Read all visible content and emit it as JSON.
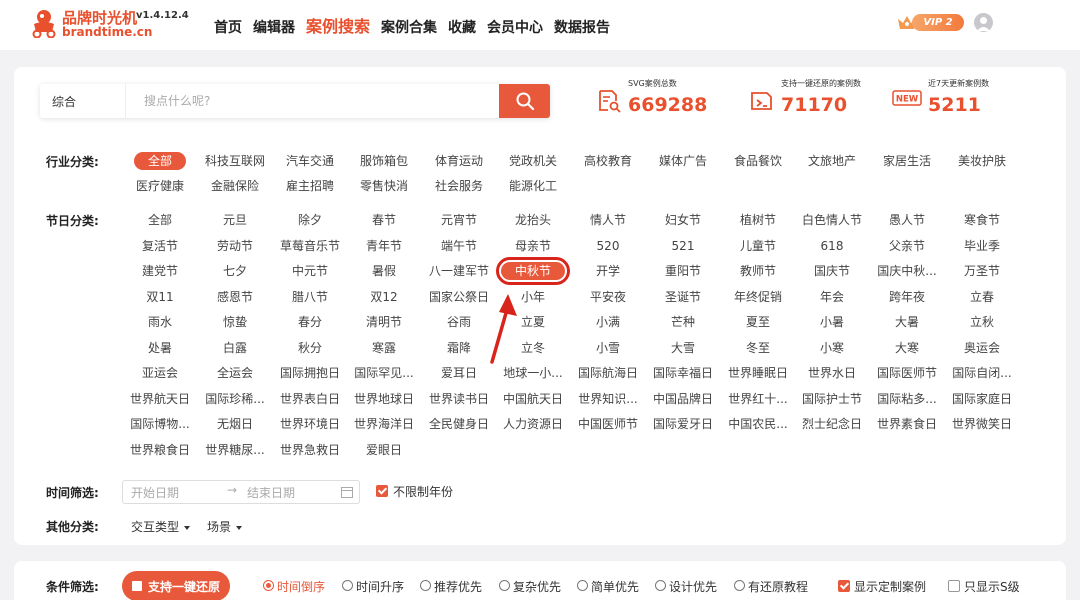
{
  "header": {
    "logo_name": "品牌时光机",
    "version": "v1.4.12.4",
    "domain": "brandtime.cn",
    "nav": [
      "首页",
      "编辑器",
      "案例搜索",
      "案例合集",
      "收藏",
      "会员中心",
      "数据报告"
    ],
    "active_nav": "案例搜索",
    "vip_label": "VIP 2"
  },
  "search": {
    "category": "综合",
    "placeholder": "搜点什么呢?"
  },
  "stats": [
    {
      "label": "SVG案例总数",
      "value": "669288",
      "icon": "document-search-icon"
    },
    {
      "label": "支持一键还原的案例数",
      "value": "71170",
      "icon": "restore-icon"
    },
    {
      "label": "近7天更新案例数",
      "value": "5211",
      "icon": "new-badge-icon",
      "badge": "NEW"
    }
  ],
  "industry": {
    "label": "行业分类:",
    "tags": [
      "全部",
      "科技互联网",
      "汽车交通",
      "服饰箱包",
      "体育运动",
      "党政机关",
      "高校教育",
      "媒体广告",
      "食品餐饮",
      "文旅地产",
      "家居生活",
      "美妆护肤",
      "医疗健康",
      "金融保险",
      "雇主招聘",
      "零售快消",
      "社会服务",
      "能源化工"
    ],
    "active": "全部"
  },
  "holiday": {
    "label": "节日分类:",
    "tags": [
      "全部",
      "元旦",
      "除夕",
      "春节",
      "元宵节",
      "龙抬头",
      "情人节",
      "妇女节",
      "植树节",
      "白色情人节",
      "愚人节",
      "寒食节",
      "复活节",
      "劳动节",
      "草莓音乐节",
      "青年节",
      "端午节",
      "母亲节",
      "520",
      "521",
      "儿童节",
      "618",
      "父亲节",
      "毕业季",
      "建党节",
      "七夕",
      "中元节",
      "暑假",
      "八一建军节",
      "中秋节",
      "开学",
      "重阳节",
      "教师节",
      "国庆节",
      "国庆中秋...",
      "万圣节",
      "双11",
      "感恩节",
      "腊八节",
      "双12",
      "国家公祭日",
      "小年",
      "平安夜",
      "圣诞节",
      "年终促销",
      "年会",
      "跨年夜",
      "立春",
      "雨水",
      "惊蛰",
      "春分",
      "清明节",
      "谷雨",
      "立夏",
      "小满",
      "芒种",
      "夏至",
      "小暑",
      "大暑",
      "立秋",
      "处暑",
      "白露",
      "秋分",
      "寒露",
      "霜降",
      "立冬",
      "小雪",
      "大雪",
      "冬至",
      "小寒",
      "大寒",
      "奥运会",
      "亚运会",
      "全运会",
      "国际拥抱日",
      "国际罕见...",
      "爱耳日",
      "地球一小...",
      "国际航海日",
      "国际幸福日",
      "世界睡眠日",
      "世界水日",
      "国际医师节",
      "国际自闭...",
      "世界航天日",
      "国际珍稀...",
      "世界表白日",
      "世界地球日",
      "世界读书日",
      "中国航天日",
      "世界知识...",
      "中国品牌日",
      "世界红十...",
      "国际护士节",
      "国际粘多...",
      "国际家庭日",
      "国际博物...",
      "无烟日",
      "世界环境日",
      "世界海洋日",
      "全民健身日",
      "人力资源日",
      "中国医师节",
      "国际爱牙日",
      "中国农民...",
      "烈士纪念日",
      "世界素食日",
      "世界微笑日",
      "世界粮食日",
      "世界糖尿...",
      "世界急救日",
      "爱眼日"
    ],
    "active": "中秋节"
  },
  "time_filter": {
    "label": "时间筛选:",
    "start_placeholder": "开始日期",
    "end_placeholder": "结束日期",
    "unlimited_label": "不限制年份",
    "unlimited_checked": true
  },
  "other": {
    "label": "其他分类:",
    "dropdowns": [
      "交互类型",
      "场景"
    ]
  },
  "conditions": {
    "label": "条件筛选:",
    "restore_button": "支持一键还原",
    "sort_options": [
      "时间倒序",
      "时间升序",
      "推荐优先",
      "复杂优先",
      "简单优先",
      "设计优先",
      "有还原教程"
    ],
    "selected_sort": "时间倒序",
    "show_custom_label": "显示定制案例",
    "show_custom_checked": true,
    "only_s_label": "只显示S级",
    "only_s_checked": false
  },
  "colors": {
    "accent": "#e8583a",
    "highlight_box": "#d9241c"
  }
}
